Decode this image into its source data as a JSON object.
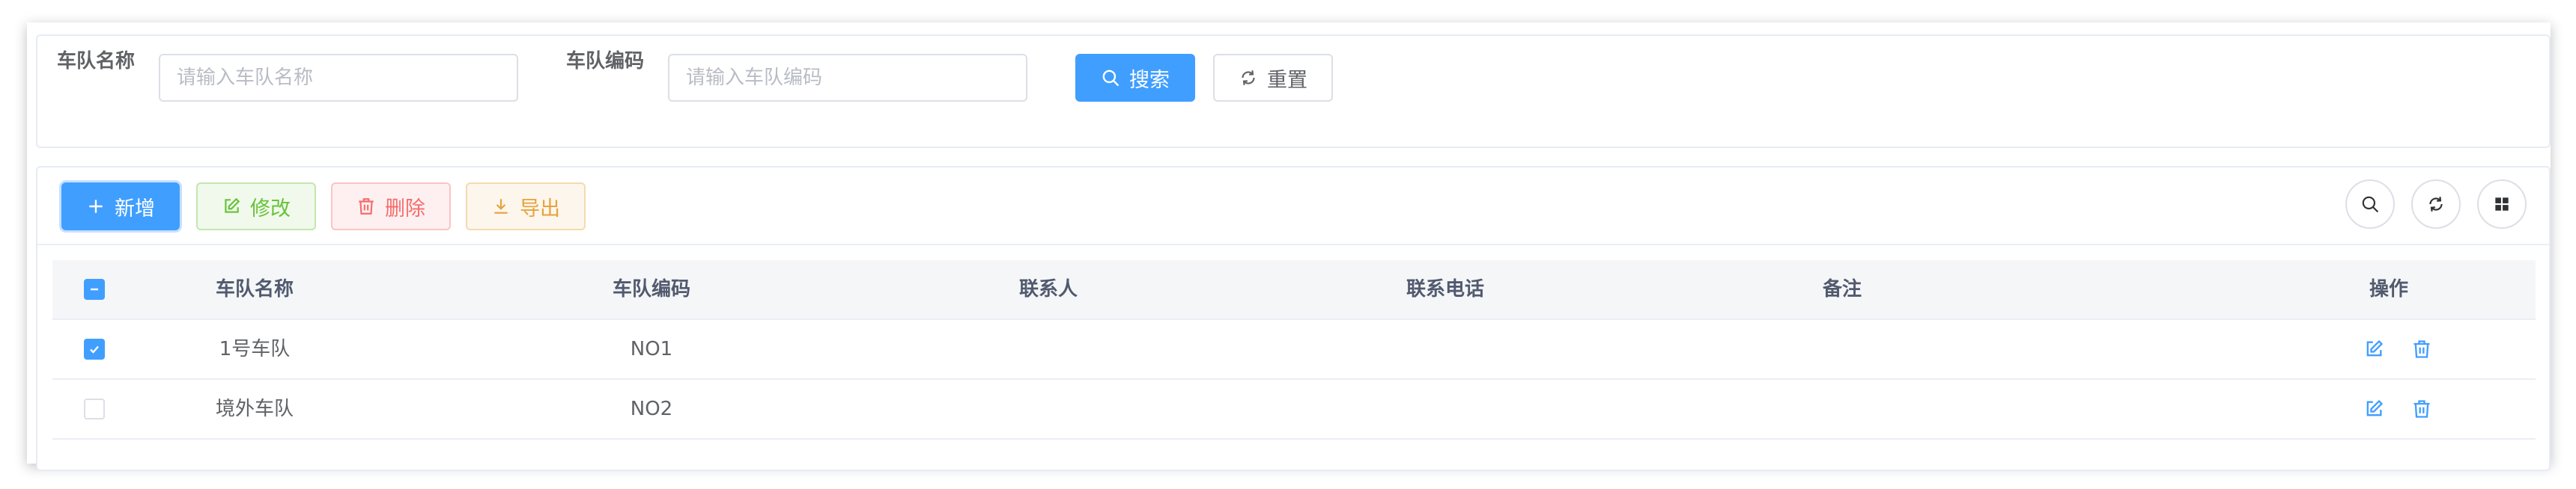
{
  "search": {
    "team_name_label": "车队名称",
    "team_name_placeholder": "请输入车队名称",
    "team_code_label": "车队编码",
    "team_code_placeholder": "请输入车队编码",
    "search_button": "搜索",
    "reset_button": "重置"
  },
  "toolbar": {
    "add_button": "新增",
    "edit_button": "修改",
    "delete_button": "删除",
    "export_button": "导出"
  },
  "table": {
    "columns": [
      "车队名称",
      "车队编码",
      "联系人",
      "联系电话",
      "备注",
      "操作"
    ],
    "rows": [
      {
        "checked": true,
        "name": "1号车队",
        "code": "NO1",
        "contact": "",
        "phone": "",
        "remark": ""
      },
      {
        "checked": false,
        "name": "境外车队",
        "code": "NO2",
        "contact": "",
        "phone": "",
        "remark": ""
      }
    ]
  },
  "colors": {
    "primary": "#409eff",
    "success": "#67c23a",
    "danger": "#f56c6c",
    "warning": "#e6a23c"
  },
  "icons": [
    "search-icon",
    "refresh-icon",
    "plus-icon",
    "edit-icon",
    "trash-icon",
    "download-icon",
    "grid-icon",
    "check-icon",
    "minus-icon"
  ]
}
